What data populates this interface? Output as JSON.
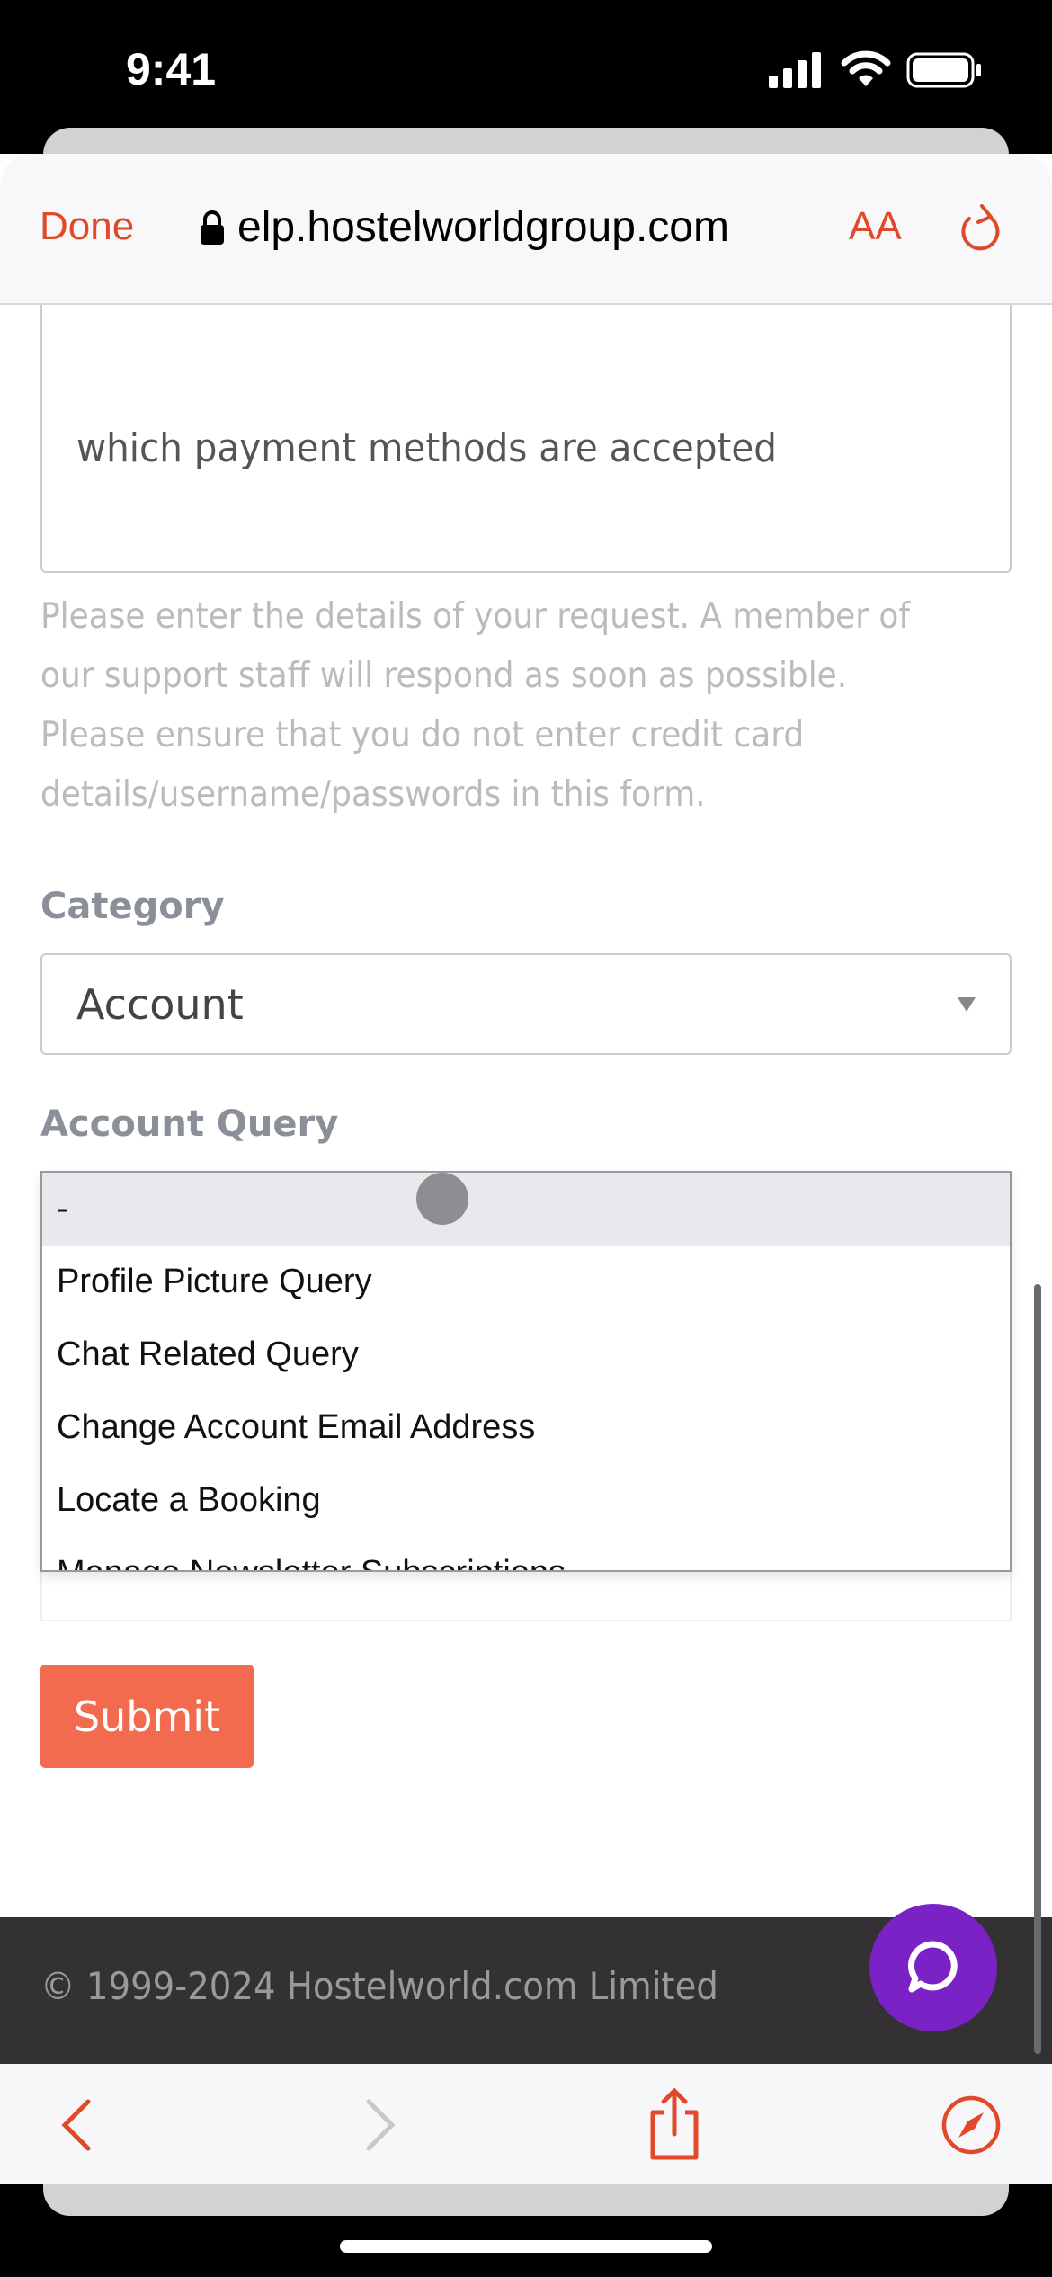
{
  "status": {
    "time": "9:41"
  },
  "browser": {
    "done_label": "Done",
    "url": "elp.hostelworldgroup.com",
    "text_size_label": "AA",
    "accent": "#e0492a"
  },
  "form": {
    "details_value": "which payment methods are accepted",
    "help_lines": [
      "Please enter the details of your request. A member of",
      "our support staff will respond as soon as possible.",
      "Please ensure that you do not enter credit card",
      "details/username/passwords in this form."
    ],
    "category_label": "Category",
    "category_value": "Account",
    "query_label": "Account Query",
    "query_options": [
      "-",
      "Profile Picture Query",
      "Chat Related Query",
      "Change Account Email Address",
      "Locate a Booking",
      "Manage Newsletter Subscriptions"
    ],
    "selected_option": "-",
    "submit_label": "Submit",
    "submit_color": "#f26b4e"
  },
  "footer": {
    "copyright": "© 1999-2024 Hostelworld.com Limited",
    "chat_color": "#7b22c7"
  }
}
